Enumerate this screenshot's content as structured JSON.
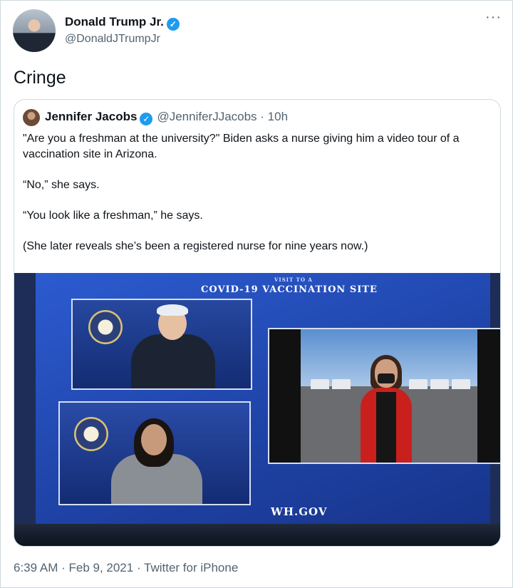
{
  "tweet": {
    "author_name": "Donald Trump Jr.",
    "handle": "@DonaldJTrumpJr",
    "more_icon": "more-icon",
    "verified_icon": "verified-badge-icon",
    "text": "Cringe",
    "timestamp": "6:39 AM · Feb 9, 2021 · Twitter for iPhone"
  },
  "quote": {
    "author_name": "Jennifer Jacobs",
    "meta": "@JenniferJJacobs · 10h",
    "paragraphs": [
      "\"Are you a freshman at the university?\" Biden asks a nurse giving him a video tour of a vaccination site in Arizona.",
      "“No,” she says.",
      "“You look like a freshman,” he says.",
      "(She later reveals she’s been a registered nurse for nine years now.)"
    ],
    "image": {
      "small_heading": "VISIT TO A",
      "title": "COVID-19 VACCINATION SITE",
      "footer": "WH.GOV"
    }
  },
  "colors": {
    "accent": "#1d9bf0",
    "secondary_text": "#536471",
    "border": "#cfd9de"
  }
}
